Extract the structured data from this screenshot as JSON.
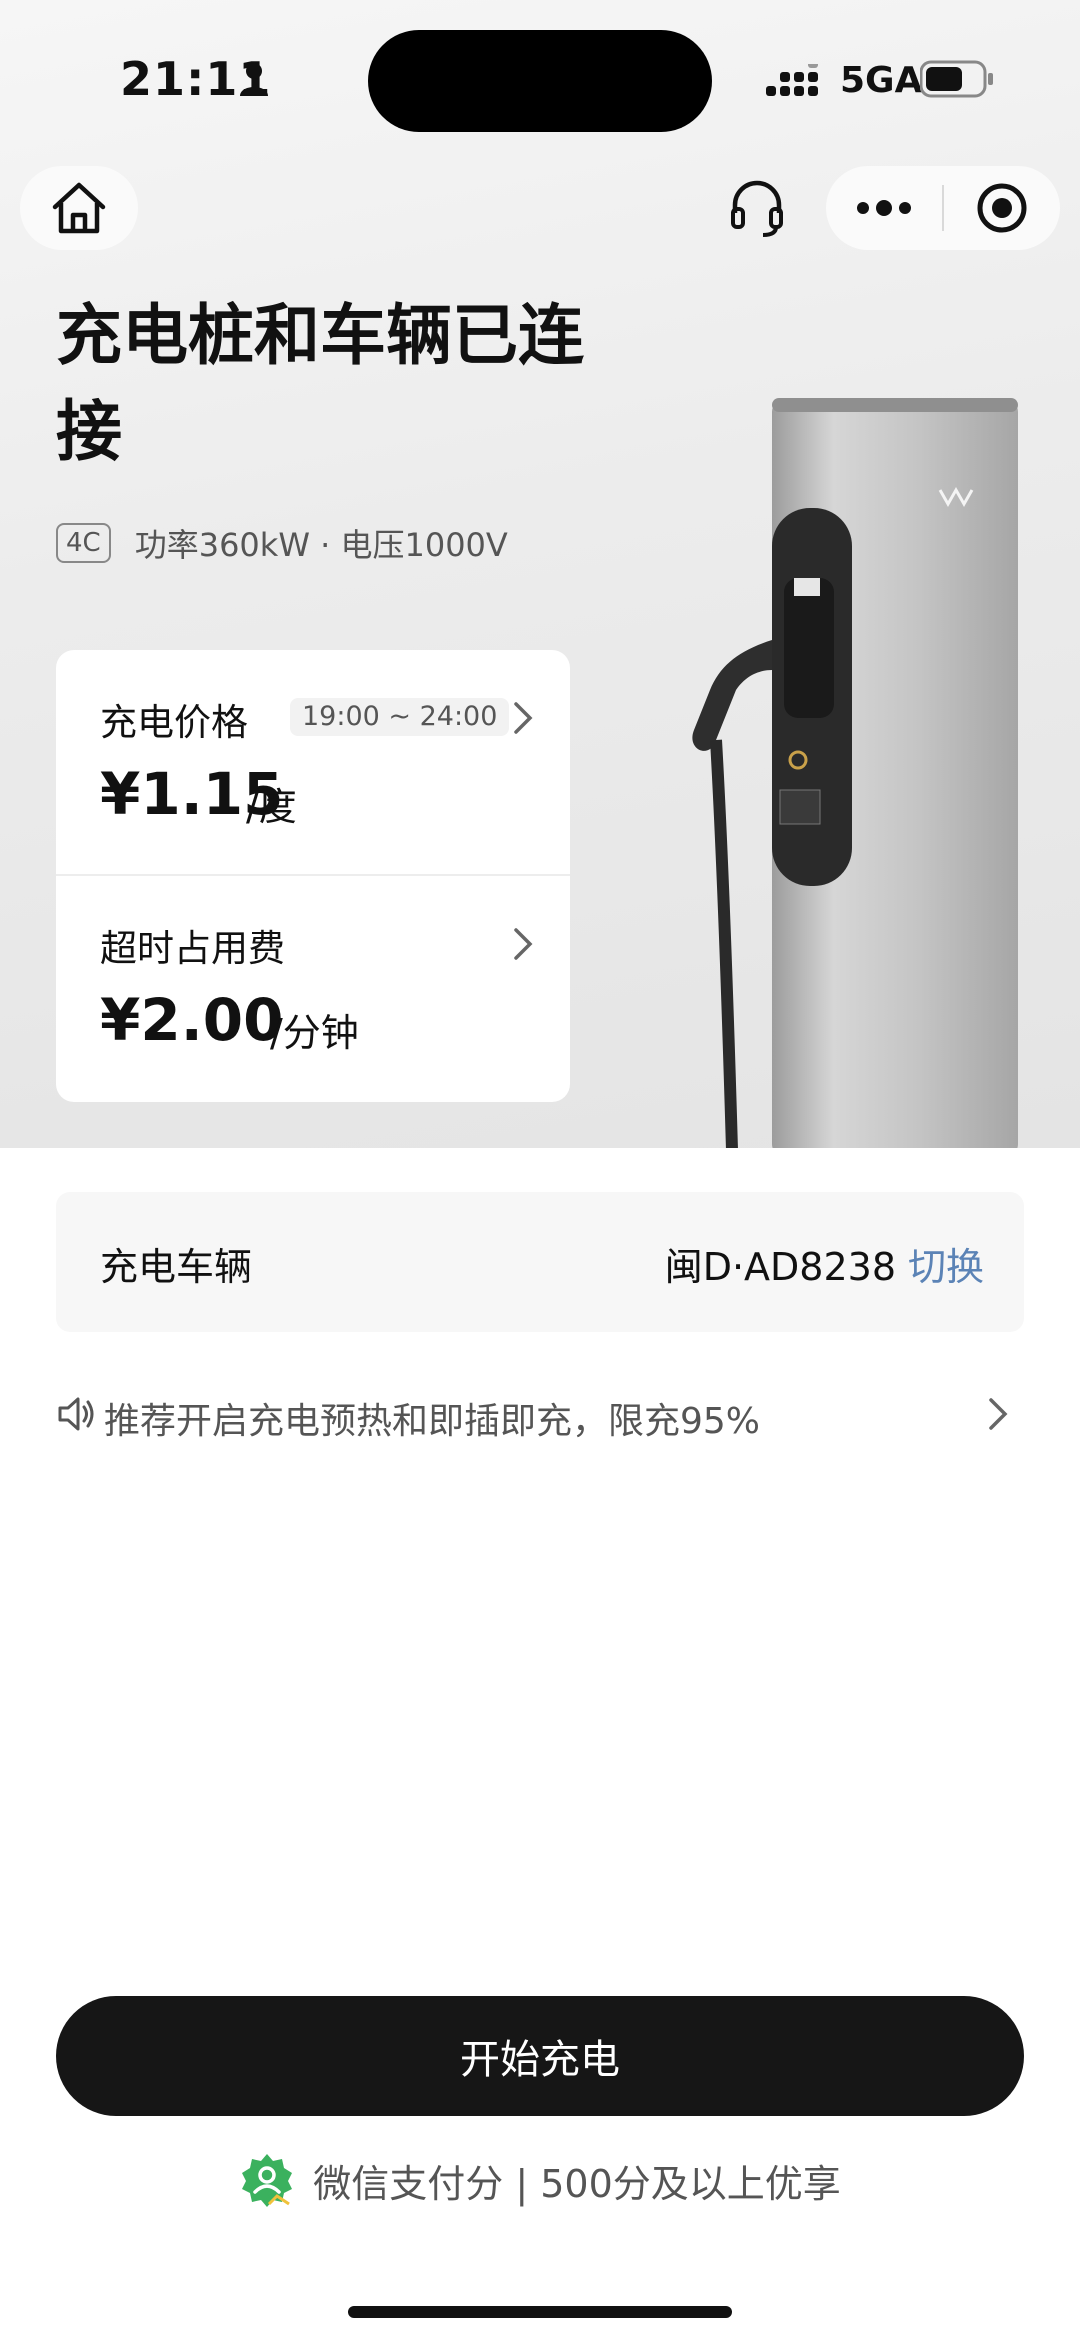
{
  "status_bar": {
    "time": "21:11",
    "network": "5GA"
  },
  "header": {
    "title": "充电桩和车辆已连接",
    "badge": "4C",
    "specs": "功率360kW · 电压1000V"
  },
  "price_card": {
    "charging_price": {
      "label": "充电价格",
      "time_range": "19:00 ~ 24:00",
      "amount": "¥1.15",
      "unit": "/度"
    },
    "overtime_fee": {
      "label": "超时占用费",
      "amount": "¥2.00",
      "unit": "/分钟"
    }
  },
  "vehicle": {
    "label": "充电车辆",
    "plate": "闽D·AD8238",
    "switch_label": "切换"
  },
  "tip": {
    "text": "推荐开启充电预热和即插即充，限充95%"
  },
  "actions": {
    "start_label": "开始充电"
  },
  "payment": {
    "text": "微信支付分 | 500分及以上优享"
  },
  "colors": {
    "accent_link": "#5b83b6",
    "button_bg": "#161616",
    "wechat_green": "#3bb15e"
  }
}
